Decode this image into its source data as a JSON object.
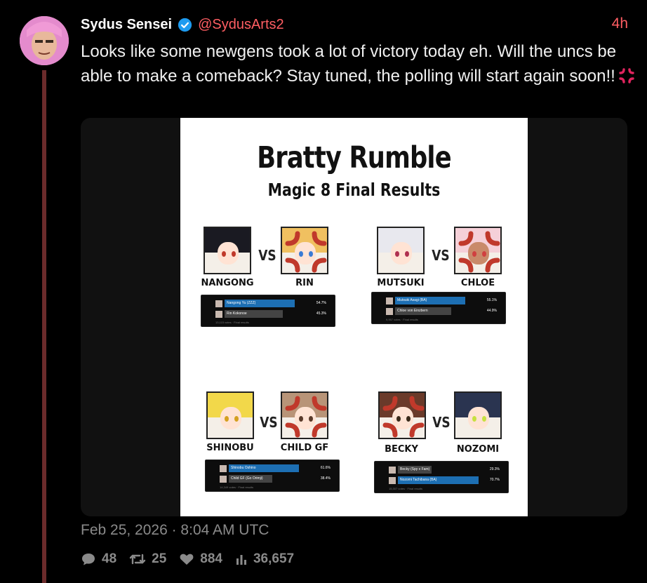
{
  "tweet": {
    "display_name": "Sydus Sensei",
    "handle": "@SydusArts2",
    "time_ago": "4h",
    "text": "Looks like some newgens took a lot of victory today eh. Will the uncs be able to make a comeback? Stay tuned, the polling will start again soon!!",
    "emoji_icon": "anger-symbol-icon",
    "timestamp": "Feb 25, 2026 · 8:04 AM UTC",
    "stats": {
      "comments": "48",
      "retweets": "25",
      "likes": "884",
      "views": "36,657"
    }
  },
  "poster": {
    "title": "Bratty Rumble",
    "subtitle": "Magic 8 Final Results",
    "vs_label": "VS",
    "matches": [
      {
        "left_name": "NANGONG",
        "right_name": "RIN",
        "poll": [
          {
            "label": "Nangong Yu (ZZZ)",
            "pct": "54.7%"
          },
          {
            "label": "Rin Kokonoe",
            "pct": "45.3%"
          }
        ],
        "footer": "13,115 votes · Final results"
      },
      {
        "left_name": "MUTSUKI",
        "right_name": "CHLOE",
        "poll": [
          {
            "label": "Mutsuki Asagi (BA)",
            "pct": "55.1%"
          },
          {
            "label": "Chloe von Einzbern",
            "pct": "44.9%"
          }
        ],
        "footer": "9,957 votes · Final results"
      },
      {
        "left_name": "SHINOBU",
        "right_name": "CHILD GF",
        "poll": [
          {
            "label": "Shinobu Oshino",
            "pct": "61.6%"
          },
          {
            "label": "Child GF (Go Orimji)",
            "pct": "38.4%"
          }
        ],
        "footer": "14,349 votes · Final results"
      },
      {
        "left_name": "BECKY",
        "right_name": "NOZOMI",
        "poll": [
          {
            "label": "Becky (Spy x Fam)",
            "pct": "29.3%"
          },
          {
            "label": "Nozomi Tachibana (BA)",
            "pct": "70.7%"
          }
        ],
        "footer": "15,307 votes · Final results"
      }
    ]
  },
  "colors": {
    "accent": "#ff5e63",
    "verified": "#1d9bf0",
    "thread_line": "#6b2b2b",
    "muted": "#8a8a8a",
    "poll_winner": "#1d6fb3",
    "anger_mark": "#c0392b"
  },
  "icons": {
    "verified": "verified-badge-icon",
    "comment": "comment-icon",
    "retweet": "retweet-icon",
    "like": "heart-icon",
    "views": "views-bar-chart-icon"
  }
}
